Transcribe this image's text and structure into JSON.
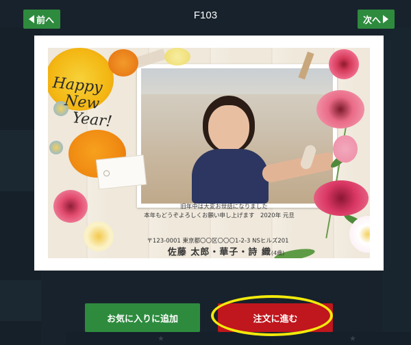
{
  "topbar": {
    "title": "F103",
    "prev_label": "前へ",
    "next_label": "次へ"
  },
  "card": {
    "greeting_lines": [
      "Happy",
      "New",
      "Year!"
    ],
    "message_line1": "旧年中は大変お世話になりました",
    "message_line2": "本年もどうぞよろしくお願い申し上げます　2020年 元旦",
    "address": "〒123-0001 東京都〇〇区〇〇〇1-2-3 NSヒルズ201",
    "names": "佐藤 太郎・華子・詩 織",
    "age": "(4歳)"
  },
  "buttons": {
    "favorite_label": "お気に入りに追加",
    "order_label": "注文に進む"
  },
  "colors": {
    "green": "#2e8b3e",
    "red": "#c0161d",
    "highlight": "#f2e90c"
  }
}
